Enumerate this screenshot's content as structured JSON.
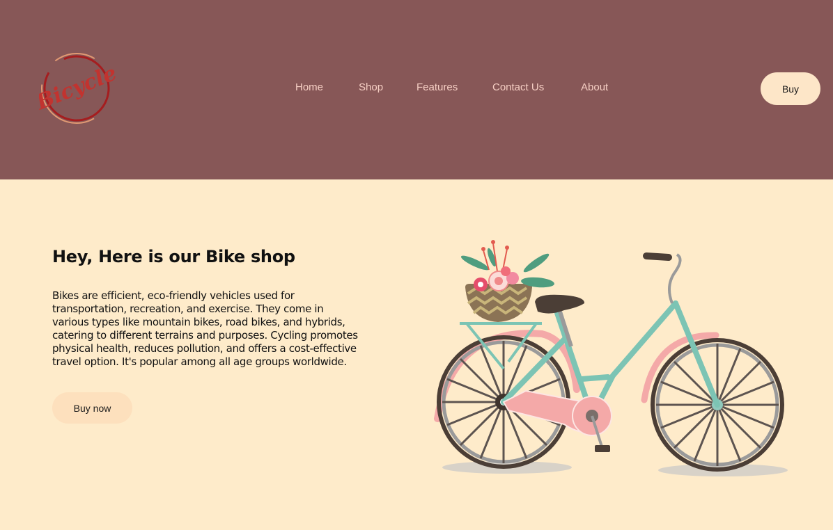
{
  "header": {
    "logo_text": "Bicycle",
    "nav": [
      {
        "label": "Home"
      },
      {
        "label": "Shop"
      },
      {
        "label": "Features"
      },
      {
        "label": "Contact Us"
      },
      {
        "label": "About"
      }
    ],
    "buy_label": "Buy"
  },
  "hero": {
    "title": "Hey, Here is our Bike shop",
    "description": "Bikes are efficient, eco-friendly vehicles used for transportation, recreation, and exercise. They come in various types like mountain bikes, road bikes, and hybrids, catering to different terrains and purposes. Cycling promotes physical health, reduces pollution, and offers a cost-effective travel option. It's popular among all age groups worldwide.",
    "cta_label": "Buy now"
  },
  "colors": {
    "header_bg": "#875757",
    "main_bg": "#feebca",
    "nav_text": "#f6cfc4",
    "button_bg": "#fde6c8",
    "logo_red": "#b82324",
    "bike_frame": "#7cc4b4",
    "bike_pink": "#f4a9a8"
  }
}
